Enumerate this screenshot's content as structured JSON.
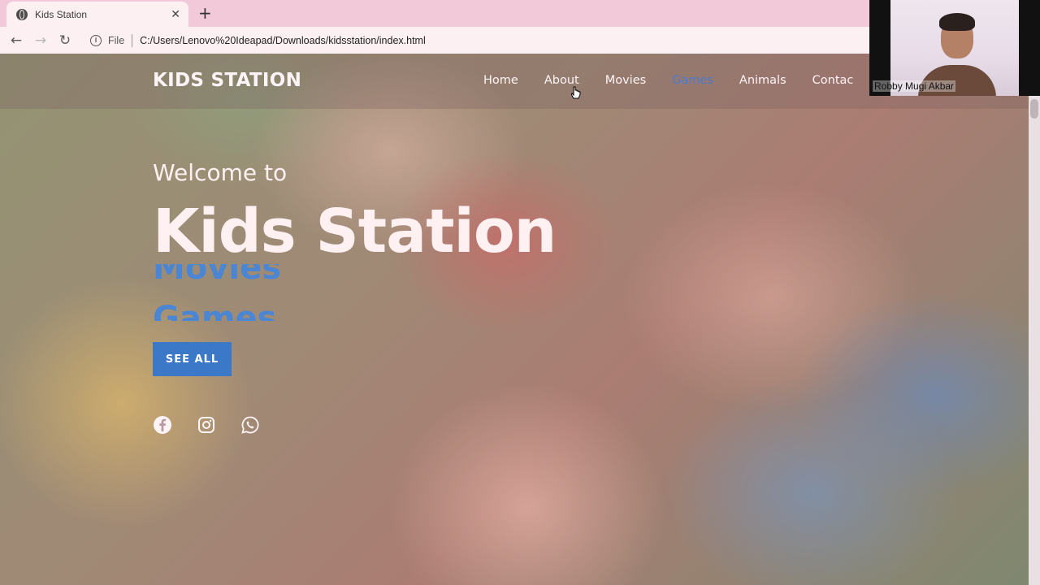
{
  "browser": {
    "tab_title": "Kids Station",
    "tab_close": "✕",
    "new_tab": "+",
    "back": "←",
    "forward": "→",
    "reload": "↻",
    "info_icon": "i",
    "file_label": "File",
    "url": "C:/Users/Lenovo%20Ideapad/Downloads/kidsstation/index.html"
  },
  "site": {
    "brand": "KIDS STATION",
    "nav": [
      {
        "label": "Home"
      },
      {
        "label": "About"
      },
      {
        "label": "Movies"
      },
      {
        "label": "Games"
      },
      {
        "label": "Animals"
      },
      {
        "label": "Contac"
      }
    ],
    "hero": {
      "welcome": "Welcome to",
      "title": "Kids Station",
      "rotating_words": [
        "Movies",
        "Games"
      ],
      "cta": "SEE ALL"
    },
    "socials": [
      "facebook-icon",
      "instagram-icon",
      "whatsapp-icon"
    ],
    "accent_color": "#3c78c8"
  },
  "webcam": {
    "name": "Robby Mugi Akbar"
  }
}
